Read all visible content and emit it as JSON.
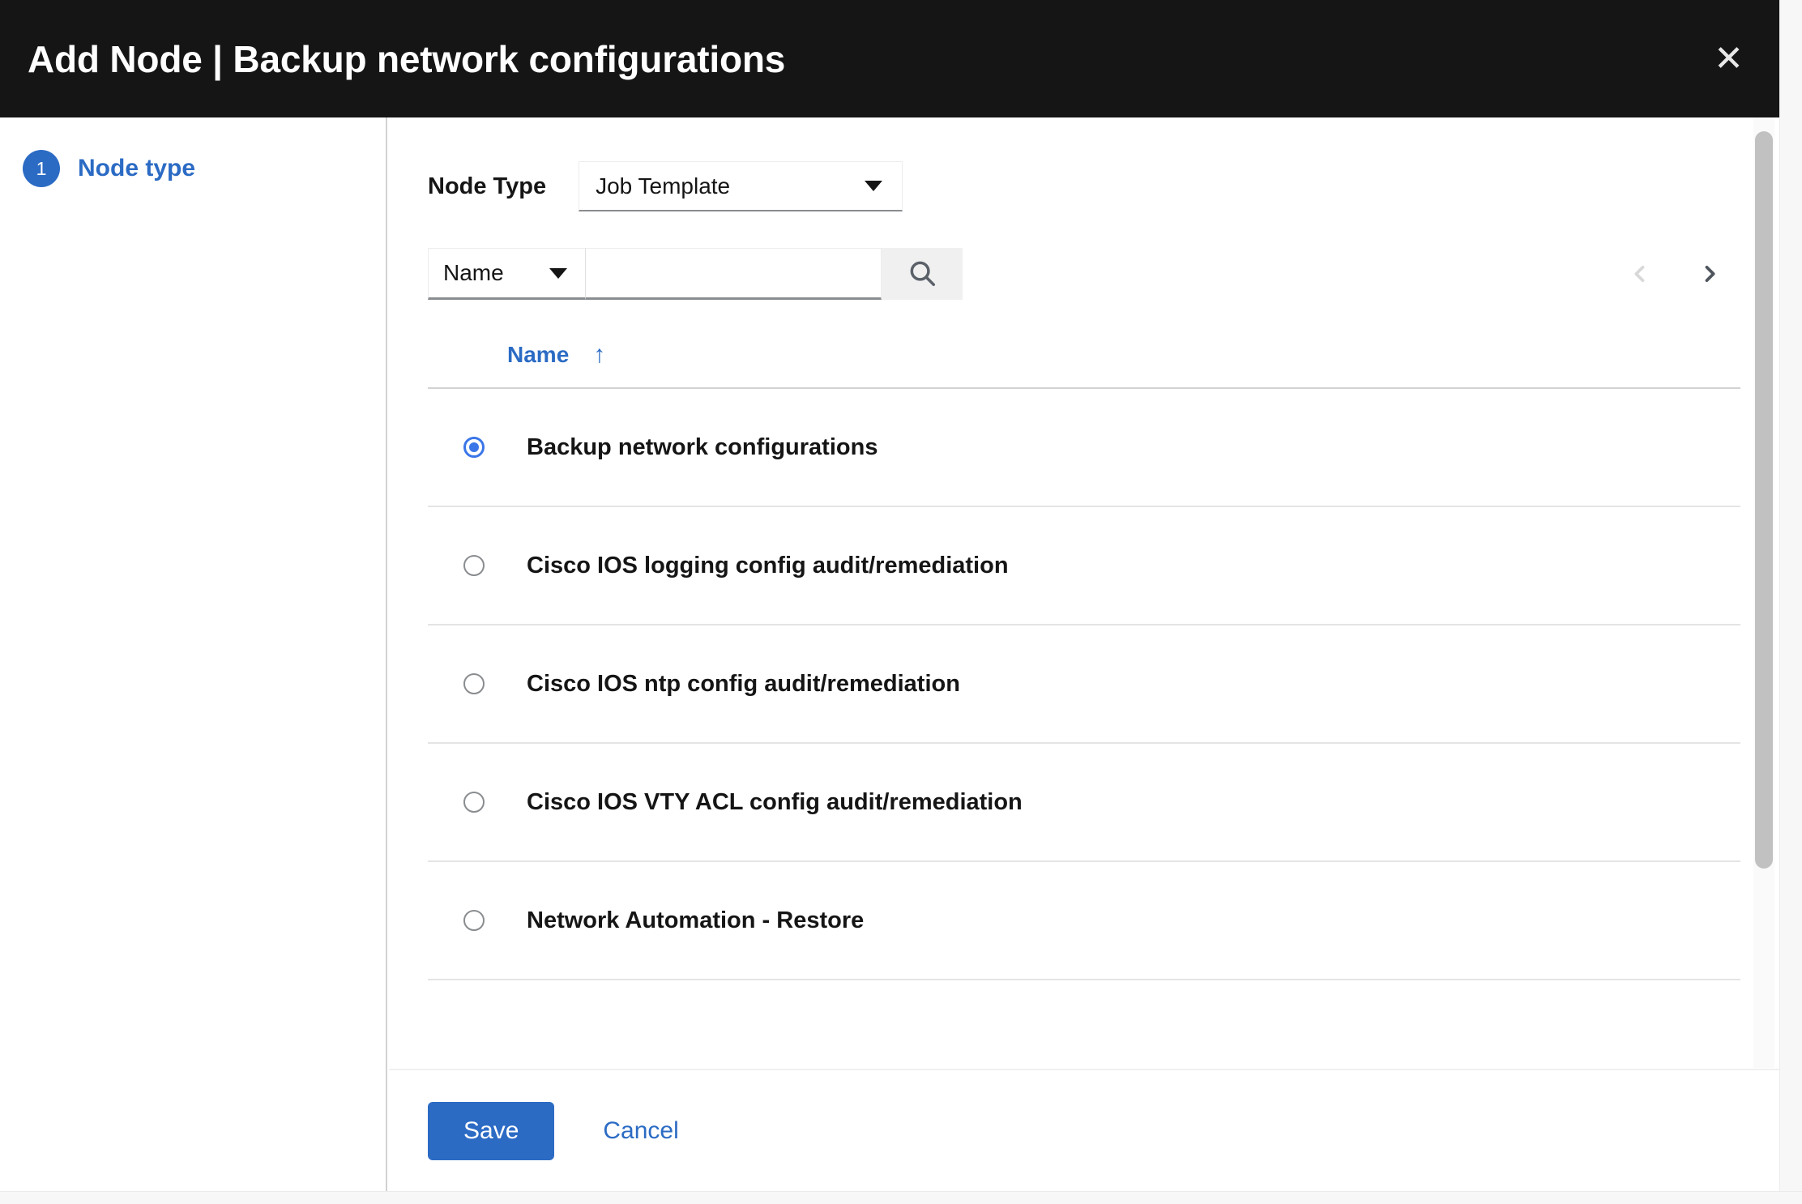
{
  "header": {
    "title": "Add Node | Backup network configurations",
    "close_label": "✕"
  },
  "steps": [
    {
      "number": "1",
      "label": "Node type"
    }
  ],
  "form": {
    "node_type_label": "Node Type",
    "node_type_value": "Job Template"
  },
  "toolbar": {
    "filter_value": "Name",
    "search_value": "",
    "search_placeholder": "",
    "search_icon": "search-icon",
    "prev_label": "‹",
    "next_label": "›"
  },
  "table": {
    "columns": [
      {
        "label": "Name",
        "sort": "↑"
      }
    ],
    "rows": [
      {
        "label": "Backup network configurations",
        "selected": true
      },
      {
        "label": "Cisco IOS logging config audit/remediation",
        "selected": false
      },
      {
        "label": "Cisco IOS ntp config audit/remediation",
        "selected": false
      },
      {
        "label": "Cisco IOS VTY ACL config audit/remediation",
        "selected": false
      },
      {
        "label": "Network Automation - Restore",
        "selected": false
      }
    ]
  },
  "footer": {
    "save_label": "Save",
    "cancel_label": "Cancel"
  },
  "colors": {
    "header_bg": "#151515",
    "accent": "#2b6bc4",
    "radio_selected": "#3b76e8",
    "divider": "#d2d2d2"
  }
}
